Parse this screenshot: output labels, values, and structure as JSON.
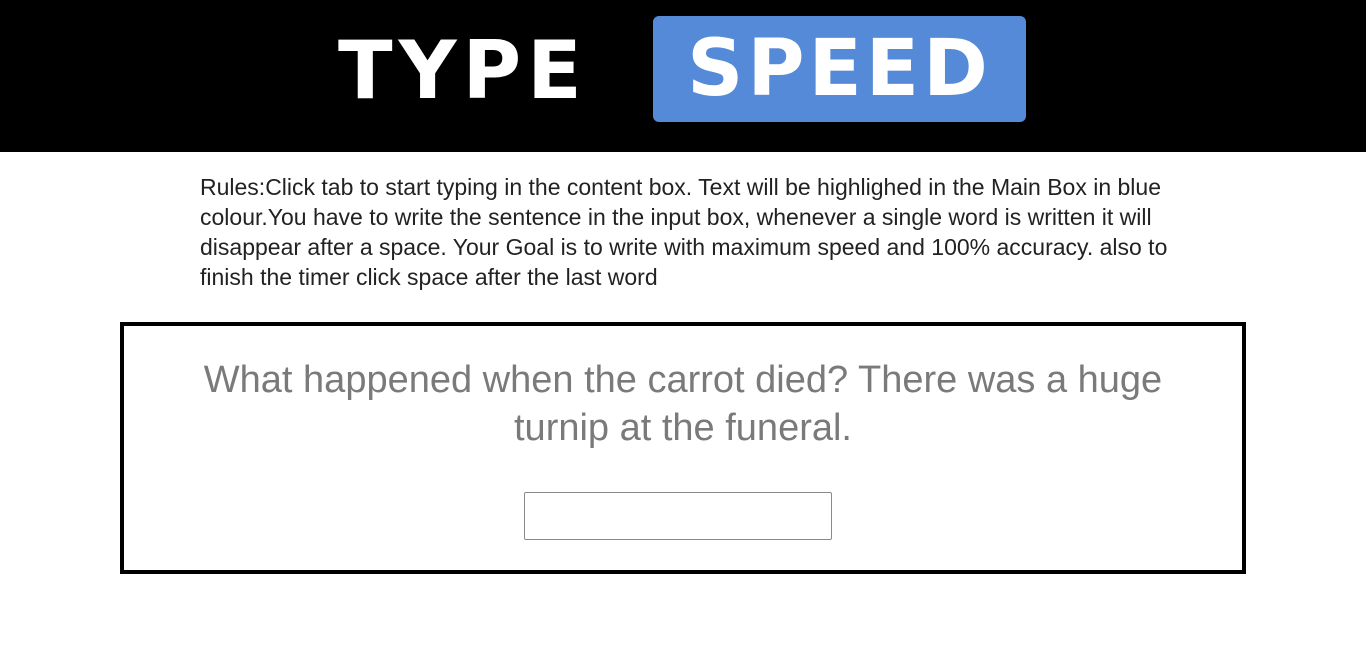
{
  "header": {
    "logo_word1": "TYPE",
    "logo_word2": "SPEED"
  },
  "rules": {
    "text": "Rules:Click tab to start typing in the content box. Text will be highlighed in the Main Box in blue colour.You have to write the sentence in the input box, whenever a single word is written it will disappear after a space. Your Goal is to write with maximum speed and 100% accuracy. also to finish the timer click space after the last word"
  },
  "main": {
    "sentence": "What happened when the carrot died? There was a huge turnip at the funeral.",
    "input_value": ""
  },
  "colors": {
    "header_bg": "#000000",
    "accent": "#558ad8",
    "sentence_text": "#7a7a7a"
  }
}
